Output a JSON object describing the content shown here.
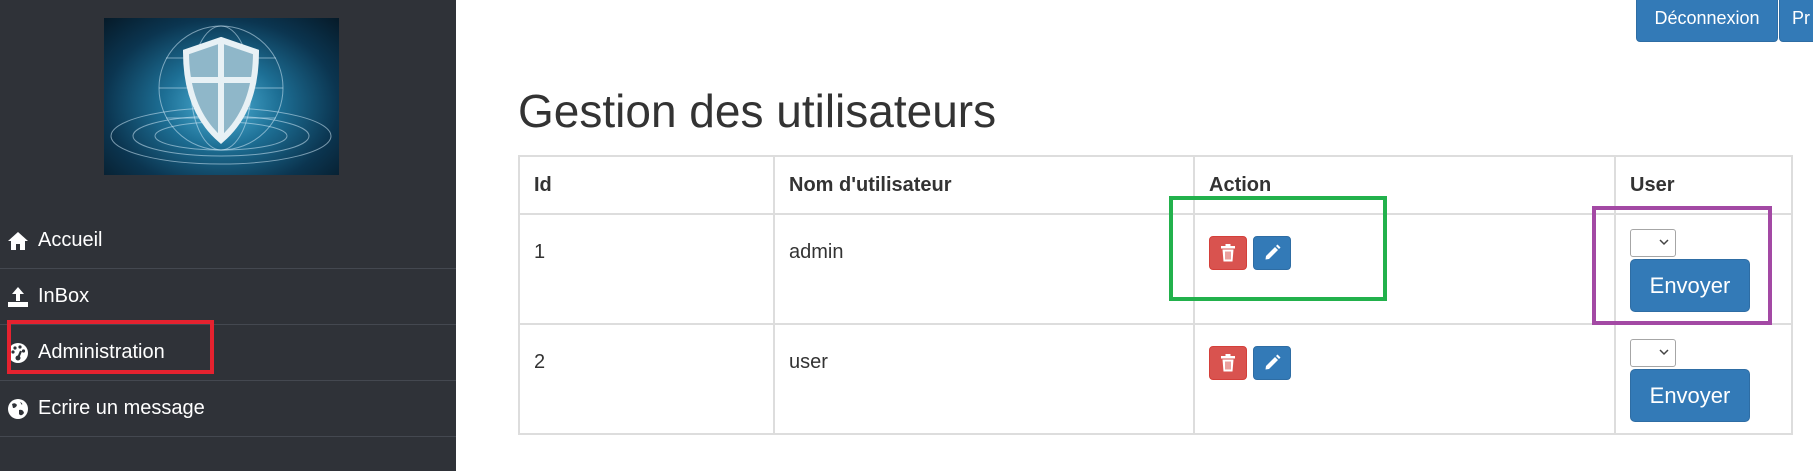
{
  "sidebar": {
    "logo_alt": "",
    "items": [
      {
        "label": "Accueil",
        "icon": "home-icon"
      },
      {
        "label": "InBox",
        "icon": "upload-icon"
      },
      {
        "label": "Administration",
        "icon": "dashboard-icon"
      },
      {
        "label": "Ecrire un message",
        "icon": "globe-icon"
      }
    ]
  },
  "header": {
    "logout_label": "Déconnexion",
    "profile_label": "Pr"
  },
  "main": {
    "title": "Gestion des utilisateurs",
    "table": {
      "columns": [
        "Id",
        "Nom d'utilisateur",
        "Action",
        "User"
      ],
      "rows": [
        {
          "id": "1",
          "username": "admin",
          "select_value": "",
          "send_label": "Envoyer"
        },
        {
          "id": "2",
          "username": "user",
          "select_value": "",
          "send_label": "Envoyer"
        }
      ]
    }
  },
  "annotations": {
    "red_box": "#e5222f",
    "green_box": "#22b14c",
    "purple_box": "#a349a4"
  },
  "colors": {
    "sidebar_bg": "#2f3238",
    "primary": "#337ab7",
    "danger": "#d9534f"
  }
}
